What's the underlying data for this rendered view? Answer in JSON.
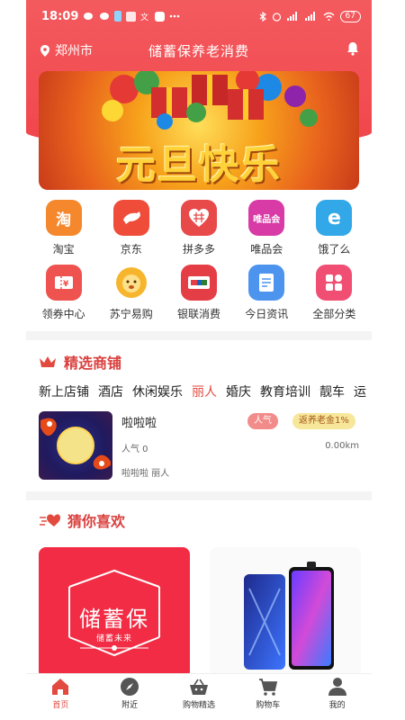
{
  "status_bar": {
    "time": "18:09",
    "battery": "67"
  },
  "header": {
    "location": "郑州市",
    "title": "储蓄保养老消费"
  },
  "banner": {
    "text": "元旦快乐"
  },
  "categories": [
    {
      "label": "淘宝",
      "icon": "taobao-icon",
      "glyph": "淘",
      "color": "#f5872d"
    },
    {
      "label": "京东",
      "icon": "jd-dog-icon",
      "glyph": "",
      "color": "#ef4c3a"
    },
    {
      "label": "拼多多",
      "icon": "pinduoduo-icon",
      "glyph": "",
      "color": "#e84a4a"
    },
    {
      "label": "唯品会",
      "icon": "vip-icon",
      "glyph": "唯品会",
      "color": "#d83aa6"
    },
    {
      "label": "饿了么",
      "icon": "eleme-icon",
      "glyph": "e",
      "color": "#32a8e8"
    },
    {
      "label": "领券中心",
      "icon": "coupon-icon",
      "glyph": "",
      "color": "#ef5350"
    },
    {
      "label": "苏宁易购",
      "icon": "suning-lion-icon",
      "glyph": "",
      "color": "#f6b52c"
    },
    {
      "label": "银联消费",
      "icon": "unionpay-icon",
      "glyph": "",
      "color": "#e53d45"
    },
    {
      "label": "今日资讯",
      "icon": "news-doc-icon",
      "glyph": "",
      "color": "#4d94ef"
    },
    {
      "label": "全部分类",
      "icon": "all-categories-icon",
      "glyph": "",
      "color": "#f04f73"
    }
  ],
  "featured": {
    "title": "精选商铺",
    "tabs": [
      "新上店铺",
      "酒店",
      "休闲娱乐",
      "丽人",
      "婚庆",
      "教育培训",
      "靓车",
      "运"
    ],
    "active_tab": 3,
    "shop": {
      "name": "啦啦啦",
      "badge_popularity": "人气",
      "badge_rebate": "返养老金1%",
      "popularity": "人气 0",
      "distance": "0.00km",
      "tags": "啦啦啦 丽人"
    }
  },
  "guess": {
    "title": "猜你喜欢",
    "product1": {
      "brand": "储蓄保",
      "slogan": "储蓄未来"
    }
  },
  "bottom_nav": [
    {
      "label": "首页",
      "icon": "home-icon"
    },
    {
      "label": "附近",
      "icon": "compass-icon"
    },
    {
      "label": "购物精选",
      "icon": "basket-icon"
    },
    {
      "label": "购物车",
      "icon": "cart-icon"
    },
    {
      "label": "我的",
      "icon": "user-icon"
    }
  ],
  "colors": {
    "primary": "#f1484e",
    "accent": "#e24a3f"
  }
}
